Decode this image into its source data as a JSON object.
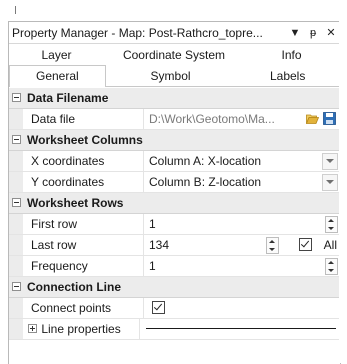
{
  "window": {
    "title": "Property Manager - Map: Post-Rathcro_topre...",
    "menu_icon": "dropdown-arrow-icon",
    "pin_icon": "pin-icon",
    "close_icon": "close-icon",
    "menu_glyph": "▼",
    "pin_glyph": "ᵽ",
    "close_glyph": "✕"
  },
  "tabs": {
    "row1": [
      "Layer",
      "Coordinate System",
      "Info"
    ],
    "row2": [
      "General",
      "Symbol",
      "Labels"
    ],
    "active": "General"
  },
  "sections": {
    "data_filename": {
      "label": "Data Filename",
      "data_file_label": "Data file",
      "data_file_value": "D:\\Work\\Geotomo\\Ma..."
    },
    "worksheet_columns": {
      "label": "Worksheet Columns",
      "x_label": "X coordinates",
      "x_value": "Column A:  X-location",
      "y_label": "Y coordinates",
      "y_value": "Column B:  Z-location"
    },
    "worksheet_rows": {
      "label": "Worksheet Rows",
      "first_row_label": "First row",
      "first_row_value": "1",
      "last_row_label": "Last row",
      "last_row_value": "134",
      "all_label": "All",
      "all_checked": true,
      "frequency_label": "Frequency",
      "frequency_value": "1"
    },
    "connection_line": {
      "label": "Connection Line",
      "connect_points_label": "Connect points",
      "connect_points_checked": true,
      "line_properties_label": "Line properties"
    }
  },
  "colors": {
    "category_bg": "#ececec",
    "folder": "#e2b23a",
    "save": "#2f6fb6"
  }
}
